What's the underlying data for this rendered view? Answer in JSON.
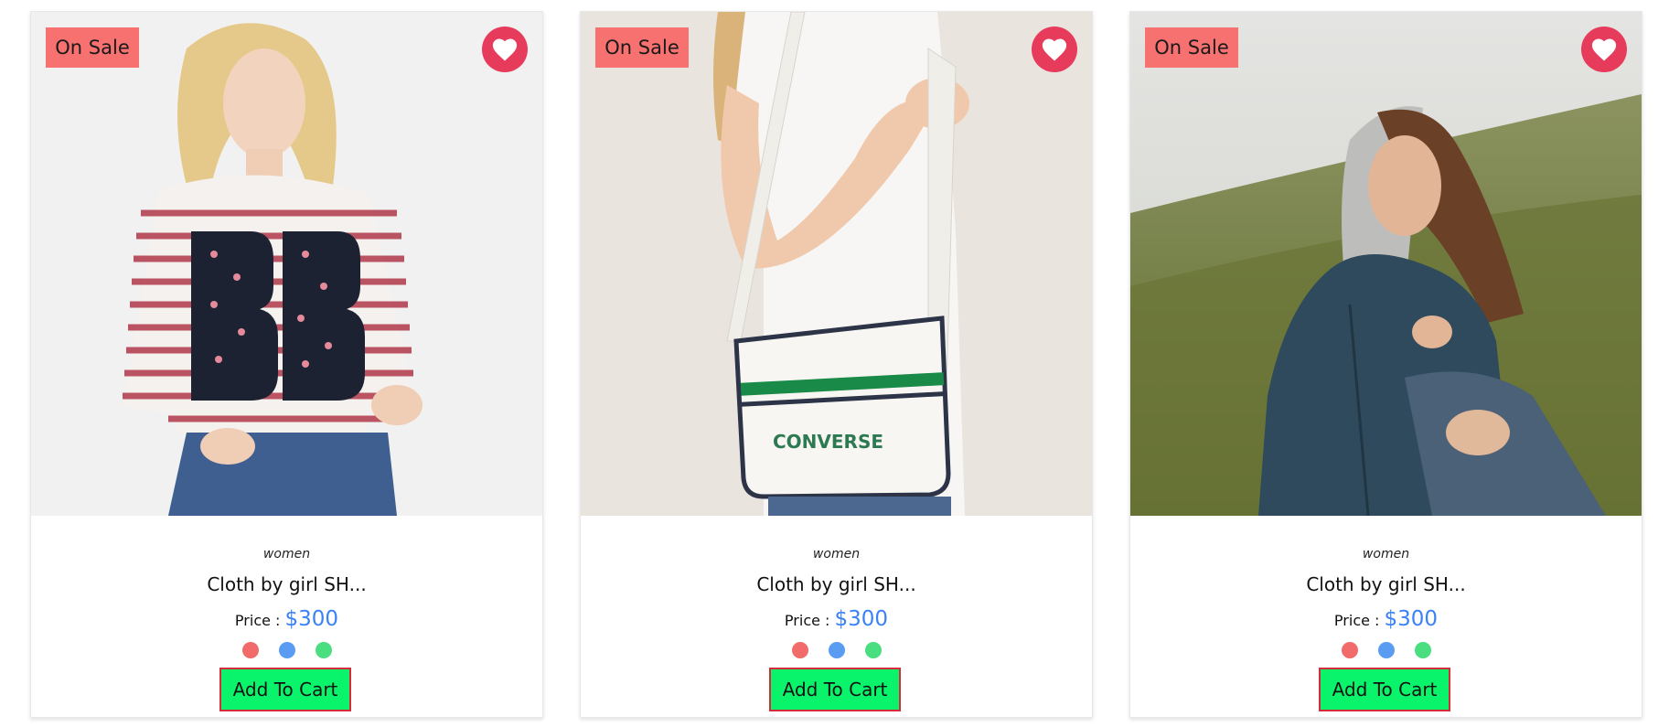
{
  "products": [
    {
      "badge": "On Sale",
      "favorite_icon": "heart-icon",
      "category": "women",
      "title": "Cloth by girl SH...",
      "price_label": "Price :",
      "price": "$300",
      "colors": [
        "#f26b6b",
        "#5b9cf3",
        "#4ade80"
      ],
      "cart_label": "Add To Cart",
      "image": "woman-striped-star-sweater-photo"
    },
    {
      "badge": "On Sale",
      "favorite_icon": "heart-icon",
      "category": "women",
      "title": "Cloth by girl SH...",
      "price_label": "Price :",
      "price": "$300",
      "colors": [
        "#f26b6b",
        "#5b9cf3",
        "#4ade80"
      ],
      "cart_label": "Add To Cart",
      "image": "white-shoulder-bag-photo",
      "bag_logo_text": "CONVERSE"
    },
    {
      "badge": "On Sale",
      "favorite_icon": "heart-icon",
      "category": "women",
      "title": "Cloth by girl SH...",
      "price_label": "Price :",
      "price": "$300",
      "colors": [
        "#f26b6b",
        "#5b9cf3",
        "#4ade80"
      ],
      "cart_label": "Add To Cart",
      "image": "woman-denim-jacket-field-photo"
    }
  ],
  "theme": {
    "badge_bg": "#f87171",
    "favorite_bg": "#e63b5b",
    "price_color": "#3b82f6",
    "cart_bg": "#09f46a",
    "cart_border": "#d62b3a"
  }
}
